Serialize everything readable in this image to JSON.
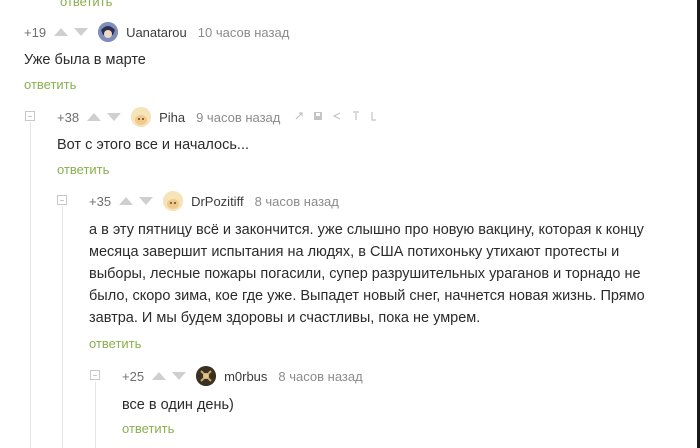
{
  "top_cut_text": "ответить",
  "colors": {
    "reply": "#8ab04d",
    "meta": "#8b8b8b",
    "text": "#2b2b2b"
  },
  "comments": [
    {
      "score": "+19",
      "username": "Uanatarou",
      "time": "10 часов назад",
      "text": "Уже была в марте",
      "reply_label": "ответить",
      "avatar_icon": "anime-avatar"
    },
    {
      "score": "+38",
      "username": "Piha",
      "time": "9 часов назад",
      "text": "Вот с этого все и началось...",
      "reply_label": "ответить",
      "avatar_icon": "cartoon-avatar",
      "tool_icons": [
        "link-icon",
        "save-icon",
        "share-icon",
        "arrow-up-icon",
        "more-icon"
      ]
    },
    {
      "score": "+35",
      "username": "DrPozitiff",
      "time": "8 часов назад",
      "text_lines": [
        "а в эту пятницу всё и закончится. уже слышно про новую вакцину, которая к концу",
        "месяца завершит испытания на людях, в США потихоньку утихают протесты и",
        "выборы, лесные пожары погасили, супер разрушительных ураганов и торнадо не",
        "было, скоро зима, кое где уже. Выпадет новый снег, начнется новая жизнь. Прямо",
        "завтра. И мы будем здоровы и счастливы, пока не умрем."
      ],
      "reply_label": "ответить",
      "avatar_icon": "cartoon-avatar"
    },
    {
      "score": "+25",
      "username": "m0rbus",
      "time": "8 часов назад",
      "text": "все в один день)",
      "reply_label": "ответить",
      "avatar_icon": "dark-avatar"
    }
  ]
}
